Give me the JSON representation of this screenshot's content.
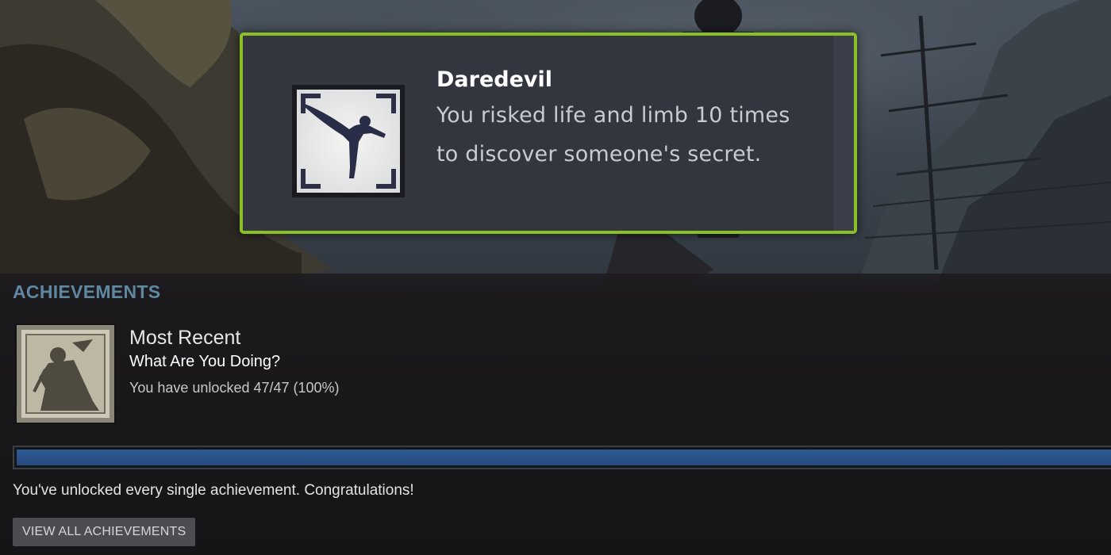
{
  "toast": {
    "title": "Daredevil",
    "description": "You risked life and limb 10 times to discover someone's secret.",
    "icon": "daredevil-achievement-icon",
    "border_color": "#8ac025",
    "background_color": "#33353f"
  },
  "achievements": {
    "heading": "ACHIEVEMENTS",
    "heading_color": "#6c9bb7",
    "most_recent": {
      "heading": "Most Recent",
      "name": "What Are You Doing?",
      "progress_text": "You have unlocked 47/47 (100%)",
      "icon": "what-are-you-doing-achievement-icon"
    },
    "progress": {
      "unlocked": 47,
      "total": 47,
      "fraction": 1.0,
      "fill_color": "#2f5a93"
    },
    "message": "You've unlocked every single achievement.  Congratulations!",
    "view_all_label": "VIEW ALL ACHIEVEMENTS"
  }
}
